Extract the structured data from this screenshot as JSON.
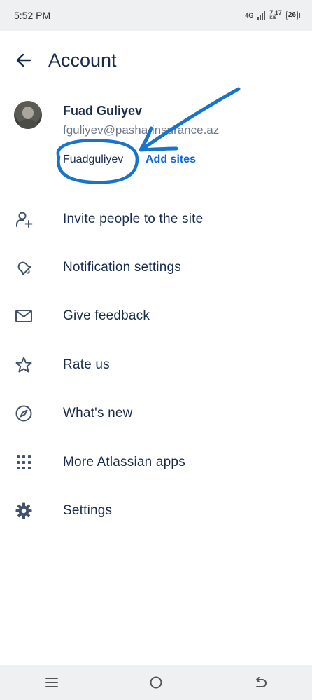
{
  "status_bar": {
    "time": "5:52 PM",
    "network": "4G",
    "speed": "7.17",
    "speed_unit": "K/S",
    "battery": "26"
  },
  "header": {
    "title": "Account"
  },
  "profile": {
    "name": "Fuad Guliyev",
    "email": "fguliyev@pasha-insurance.az",
    "site": "Fuadguliyev",
    "add_sites_label": "Add sites"
  },
  "menu": {
    "items": [
      {
        "label": "Invite people to the site",
        "icon": "add-person-icon"
      },
      {
        "label": "Notification settings",
        "icon": "bell-icon"
      },
      {
        "label": "Give feedback",
        "icon": "envelope-icon"
      },
      {
        "label": "Rate us",
        "icon": "star-icon"
      },
      {
        "label": "What's new",
        "icon": "compass-icon"
      },
      {
        "label": "More Atlassian apps",
        "icon": "grid-icon"
      },
      {
        "label": "Settings",
        "icon": "gear-icon"
      }
    ]
  },
  "annotation": {
    "color": "#1874c9"
  },
  "colors": {
    "text_primary": "#172b4d",
    "text_secondary": "#6b778c",
    "link": "#0c66e4"
  }
}
